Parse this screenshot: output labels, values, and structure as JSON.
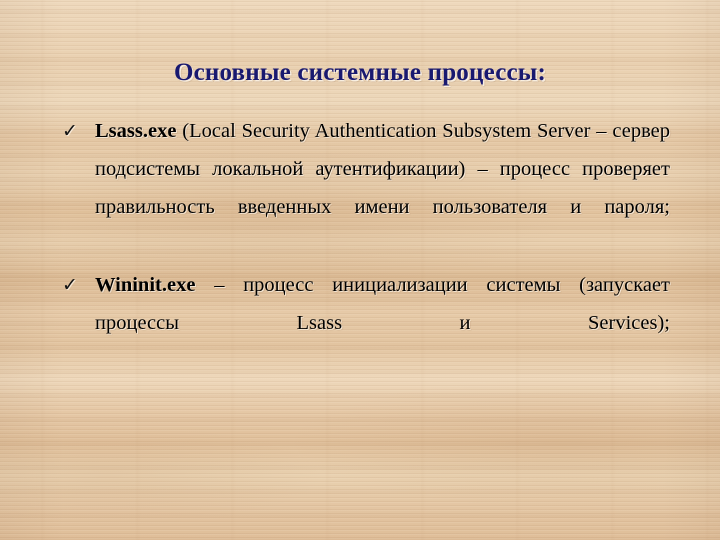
{
  "slide": {
    "title": "Основные системные процессы:",
    "title_color": "#191970",
    "background": "wood-texture",
    "background_colors": {
      "light": "#eed9bd",
      "mid": "#e6caa9",
      "dark": "#dcbb95",
      "grain": "#a0703f"
    },
    "text_color": "#000000"
  },
  "bullets": [
    {
      "marker": "check-mark",
      "marker_glyph": "✓",
      "process_name": "Lsass.exe",
      "description": "(Local Security Authentication Subsystem Server – сервер подсистемы локальной аутентификации) – процесс проверяет правильность введенных имени пользователя и пароля;"
    },
    {
      "marker": "check-mark",
      "marker_glyph": "✓",
      "process_name": "Wininit.exe",
      "description": "– процесс инициализации системы (запускает процессы Lsass и Services);"
    }
  ]
}
